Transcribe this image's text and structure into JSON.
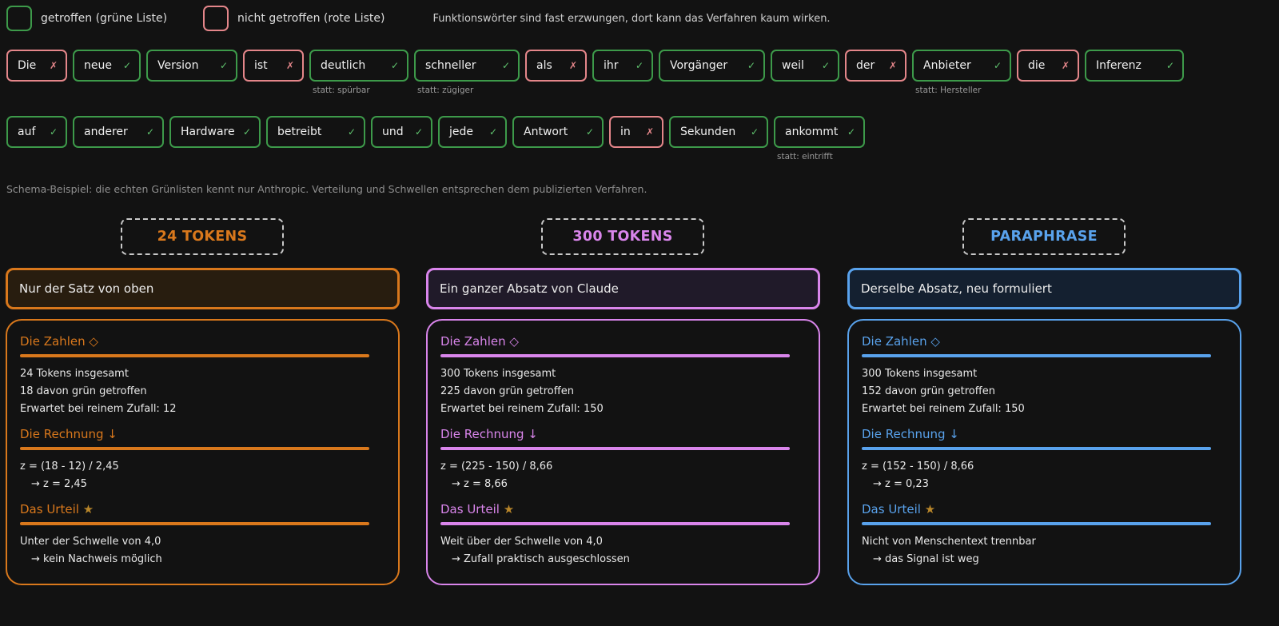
{
  "legend": {
    "hit_label": "getroffen (grüne Liste)",
    "miss_label": "nicht getroffen (rote Liste)",
    "note": "Funktionswörter sind fast erzwungen, dort kann das Verfahren kaum wirken."
  },
  "tokens_row1": [
    {
      "word": "Die",
      "hit": false,
      "sub": ""
    },
    {
      "word": "neue",
      "hit": true,
      "sub": ""
    },
    {
      "word": "Version",
      "hit": true,
      "sub": ""
    },
    {
      "word": "ist",
      "hit": false,
      "sub": ""
    },
    {
      "word": "deutlich",
      "hit": true,
      "sub": "statt: spürbar"
    },
    {
      "word": "schneller",
      "hit": true,
      "sub": "statt: zügiger"
    },
    {
      "word": "als",
      "hit": false,
      "sub": ""
    },
    {
      "word": "ihr",
      "hit": true,
      "sub": ""
    },
    {
      "word": "Vorgänger",
      "hit": true,
      "sub": ""
    },
    {
      "word": "weil",
      "hit": true,
      "sub": ""
    },
    {
      "word": "der",
      "hit": false,
      "sub": ""
    },
    {
      "word": "Anbieter",
      "hit": true,
      "sub": "statt: Hersteller"
    },
    {
      "word": "die",
      "hit": false,
      "sub": ""
    },
    {
      "word": "Inferenz",
      "hit": true,
      "sub": ""
    }
  ],
  "tokens_row2": [
    {
      "word": "auf",
      "hit": true,
      "sub": ""
    },
    {
      "word": "anderer",
      "hit": true,
      "sub": ""
    },
    {
      "word": "Hardware",
      "hit": true,
      "sub": ""
    },
    {
      "word": "betreibt",
      "hit": true,
      "sub": ""
    },
    {
      "word": "und",
      "hit": true,
      "sub": ""
    },
    {
      "word": "jede",
      "hit": true,
      "sub": ""
    },
    {
      "word": "Antwort",
      "hit": true,
      "sub": ""
    },
    {
      "word": "in",
      "hit": false,
      "sub": ""
    },
    {
      "word": "Sekunden",
      "hit": true,
      "sub": ""
    },
    {
      "word": "ankommt",
      "hit": true,
      "sub": "statt: eintrifft"
    }
  ],
  "marks": {
    "hit": "✓",
    "miss": "✗"
  },
  "schema_note": "Schema-Beispiel: die echten Grünlisten kennt nur Anthropic. Verteilung und Schwellen entsprechen dem publizierten Verfahren.",
  "columns": [
    {
      "tag": "24 TOKENS",
      "headline": "Nur der Satz von oben",
      "numbers_title": "Die Zahlen ◇",
      "numbers": [
        "24 Tokens insgesamt",
        "18 davon grün getroffen",
        "Erwartet bei reinem Zufall: 12"
      ],
      "calc_title": "Die Rechnung ↓",
      "calc": [
        "z = (18 - 12) / 2,45",
        "→ z = 2,45"
      ],
      "verdict_title": "Das Urteil",
      "verdict": [
        "Unter der Schwelle von 4,0",
        "→ kein Nachweis möglich"
      ],
      "accent": "#d9781c"
    },
    {
      "tag": "300 TOKENS",
      "headline": "Ein ganzer Absatz von Claude",
      "numbers_title": "Die Zahlen ◇",
      "numbers": [
        "300 Tokens insgesamt",
        "225 davon grün getroffen",
        "Erwartet bei reinem Zufall: 150"
      ],
      "calc_title": "Die Rechnung ↓",
      "calc": [
        "z = (225 - 150) / 8,66",
        "→ z = 8,66"
      ],
      "verdict_title": "Das Urteil",
      "verdict": [
        "Weit über der Schwelle von 4,0",
        "→ Zufall praktisch ausgeschlossen"
      ],
      "accent": "#d985eb"
    },
    {
      "tag": "PARAPHRASE",
      "headline": "Derselbe Absatz, neu formuliert",
      "numbers_title": "Die Zahlen ◇",
      "numbers": [
        "300 Tokens insgesamt",
        "152 davon grün getroffen",
        "Erwartet bei reinem Zufall: 150"
      ],
      "calc_title": "Die Rechnung ↓",
      "calc": [
        "z = (152 - 150) / 8,66",
        "→ z = 0,23"
      ],
      "verdict_title": "Das Urteil",
      "verdict": [
        "Nicht von Menschentext trennbar",
        "→ das Signal ist weg"
      ],
      "accent": "#59a2ec"
    }
  ],
  "colors": {
    "hit_border": "#3d9a4a",
    "miss_border": "#e4868a",
    "background": "#121212"
  }
}
